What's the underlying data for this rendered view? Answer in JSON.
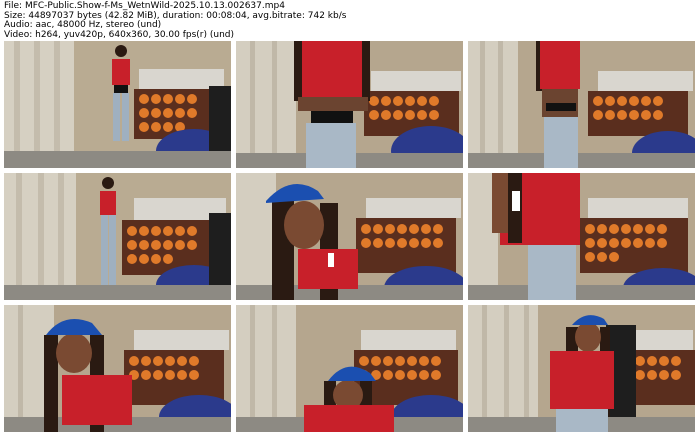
{
  "header": {
    "file_line": "File: MFC-Public.Show-f-Ms_WetnWild-2025.10.13.002637.mp4",
    "size_line": "Size: 44897037 bytes (42.82 MiB), duration: 00:08:04, avg.bitrate: 742 kb/s",
    "audio_line": "Audio: aac, 48000 Hz, stereo (und)",
    "video_line": "Video: h264, yuv420p, 640x360, 30.00 fps(r) (und)"
  },
  "thumbnails": [
    {
      "scene": "full-body-standing"
    },
    {
      "scene": "torso-closeup"
    },
    {
      "scene": "side-turn"
    },
    {
      "scene": "full-body-distant"
    },
    {
      "scene": "cap-closeup-left"
    },
    {
      "scene": "back-turn-closeup"
    },
    {
      "scene": "cap-leaning-left"
    },
    {
      "scene": "cap-low-center"
    },
    {
      "scene": "seated-chair-right"
    }
  ],
  "colors": {
    "jersey_red": "#c8202a",
    "cap_blue": "#1b4fb0",
    "pumpkin_orange": "#e07a2a",
    "wall_beige": "#b8a890",
    "curtain": "#d8d2c4"
  }
}
